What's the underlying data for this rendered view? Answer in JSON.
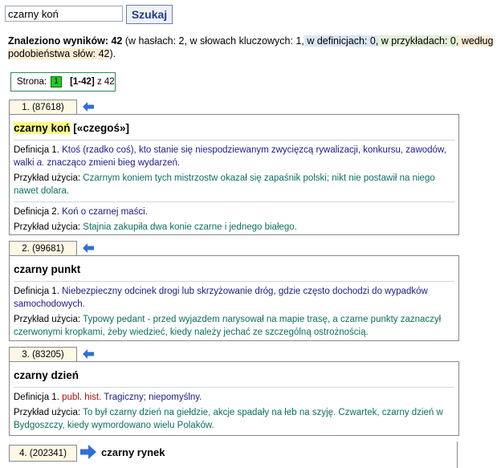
{
  "search": {
    "value": "czarny koń",
    "button_label": "Szukaj"
  },
  "summary": {
    "lead": "Znaleziono wyników: 42",
    "part1": " (w hasłach: 2, w słowach kluczowych: 1,",
    "in_defs": " w definicjach: 0,",
    "in_examples": " w przykładach: 0,",
    "by_similarity": " według podobieństwa słów: 42",
    "end": ")."
  },
  "pager": {
    "label": "Strona:",
    "current": "1",
    "range": "[1-42]",
    "of": "z 42"
  },
  "entries": [
    {
      "tab": "1. (87618)",
      "title_main": "czarny koń",
      "title_extra": " [«czegoś»]",
      "defs": [
        {
          "label": "Definicja 1.",
          "text": " Ktoś (rzadko coś), kto stanie się niespodziewanym zwycięzcą rywalizacji, konkursu, zawodów, walki ",
          "italic": "a.",
          "text2": " znacząco zmieni bieg wydarzeń.",
          "ex_label": "Przykład użycia:",
          "ex_text": " Czarnym koniem tych mistrzostw okazał się zapaśnik polski; nikt nie postawił na niego nawet dolara."
        },
        {
          "label": "Definicja 2.",
          "text": " Koń o czarnej maści.",
          "ex_label": "Przykład użycia:",
          "ex_text": " Stajnia zakupiła dwa konie czarne i jednego białego."
        }
      ]
    },
    {
      "tab": "2. (99681)",
      "title_main": "czarny punkt",
      "defs": [
        {
          "label": "Definicja 1.",
          "text": " Niebezpieczny odcinek drogi lub skrzyżowanie dróg, gdzie często dochodzi do wypadków samochodowych.",
          "ex_label": "Przykład użycia:",
          "ex_text": " Typowy pedant - przed wyjazdem narysował na mapie trasę, a czarne punkty zaznaczył czerwonymi kropkami, żeby wiedzieć, kiedy należy jechać ze szczególną ostrożnością."
        }
      ]
    },
    {
      "tab": "3. (83205)",
      "title_main": "czarny dzień",
      "defs": [
        {
          "label": "Definicja 1.",
          "qual": " publ. hist.",
          "text": " Tragiczny; niepomyślny.",
          "ex_label": "Przykład użycia:",
          "ex_text": " To był czarny dzień na giełdzie, akcje spadały na łeb na szyję. Czwartek, czarny dzień w Bydgoszczy, kiedy wymordowano wielu Polaków."
        }
      ]
    },
    {
      "tab": "4. (202341)",
      "title_main": "czarny rynek"
    }
  ]
}
